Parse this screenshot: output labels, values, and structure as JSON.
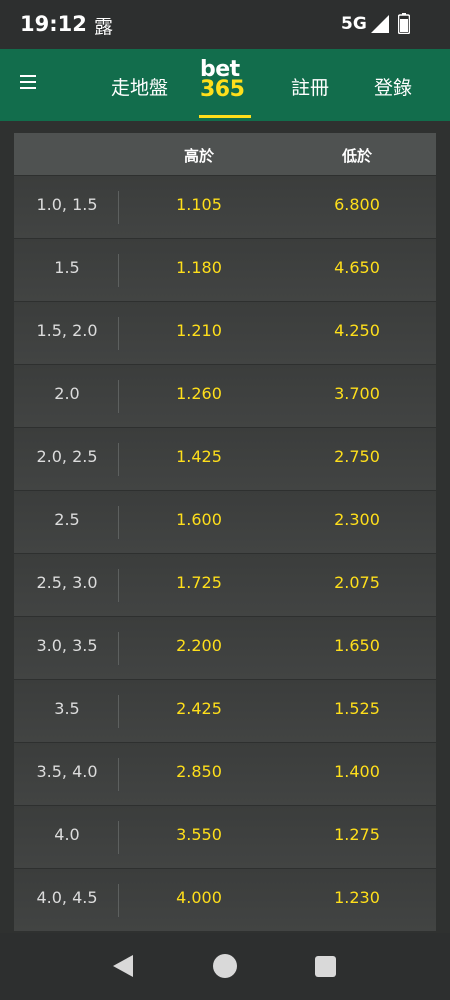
{
  "status_bar": {
    "time": "19:12",
    "notification": "露",
    "network": "5G"
  },
  "header": {
    "menu_icon": "hamburger-icon",
    "nav_inplay": "走地盤",
    "logo_top": "bet",
    "logo_bottom": "365",
    "nav_register": "註冊",
    "nav_login": "登錄"
  },
  "table": {
    "col_over": "高於",
    "col_under": "低於",
    "rows": [
      {
        "line": "1.0, 1.5",
        "over": "1.105",
        "under": "6.800"
      },
      {
        "line": "1.5",
        "over": "1.180",
        "under": "4.650"
      },
      {
        "line": "1.5, 2.0",
        "over": "1.210",
        "under": "4.250"
      },
      {
        "line": "2.0",
        "over": "1.260",
        "under": "3.700"
      },
      {
        "line": "2.0, 2.5",
        "over": "1.425",
        "under": "2.750"
      },
      {
        "line": "2.5",
        "over": "1.600",
        "under": "2.300"
      },
      {
        "line": "2.5, 3.0",
        "over": "1.725",
        "under": "2.075"
      },
      {
        "line": "3.0, 3.5",
        "over": "2.200",
        "under": "1.650"
      },
      {
        "line": "3.5",
        "over": "2.425",
        "under": "1.525"
      },
      {
        "line": "3.5, 4.0",
        "over": "2.850",
        "under": "1.400"
      },
      {
        "line": "4.0",
        "over": "3.550",
        "under": "1.275"
      },
      {
        "line": "4.0, 4.5",
        "over": "4.000",
        "under": "1.230"
      }
    ]
  },
  "colors": {
    "brand_green": "#126d4c",
    "odds_yellow": "#ffdf1b",
    "background": "#2f3130"
  },
  "nav_bar": {
    "back_icon": "back-triangle-icon",
    "home_icon": "home-circle-icon",
    "recent_icon": "recent-apps-square-icon"
  }
}
